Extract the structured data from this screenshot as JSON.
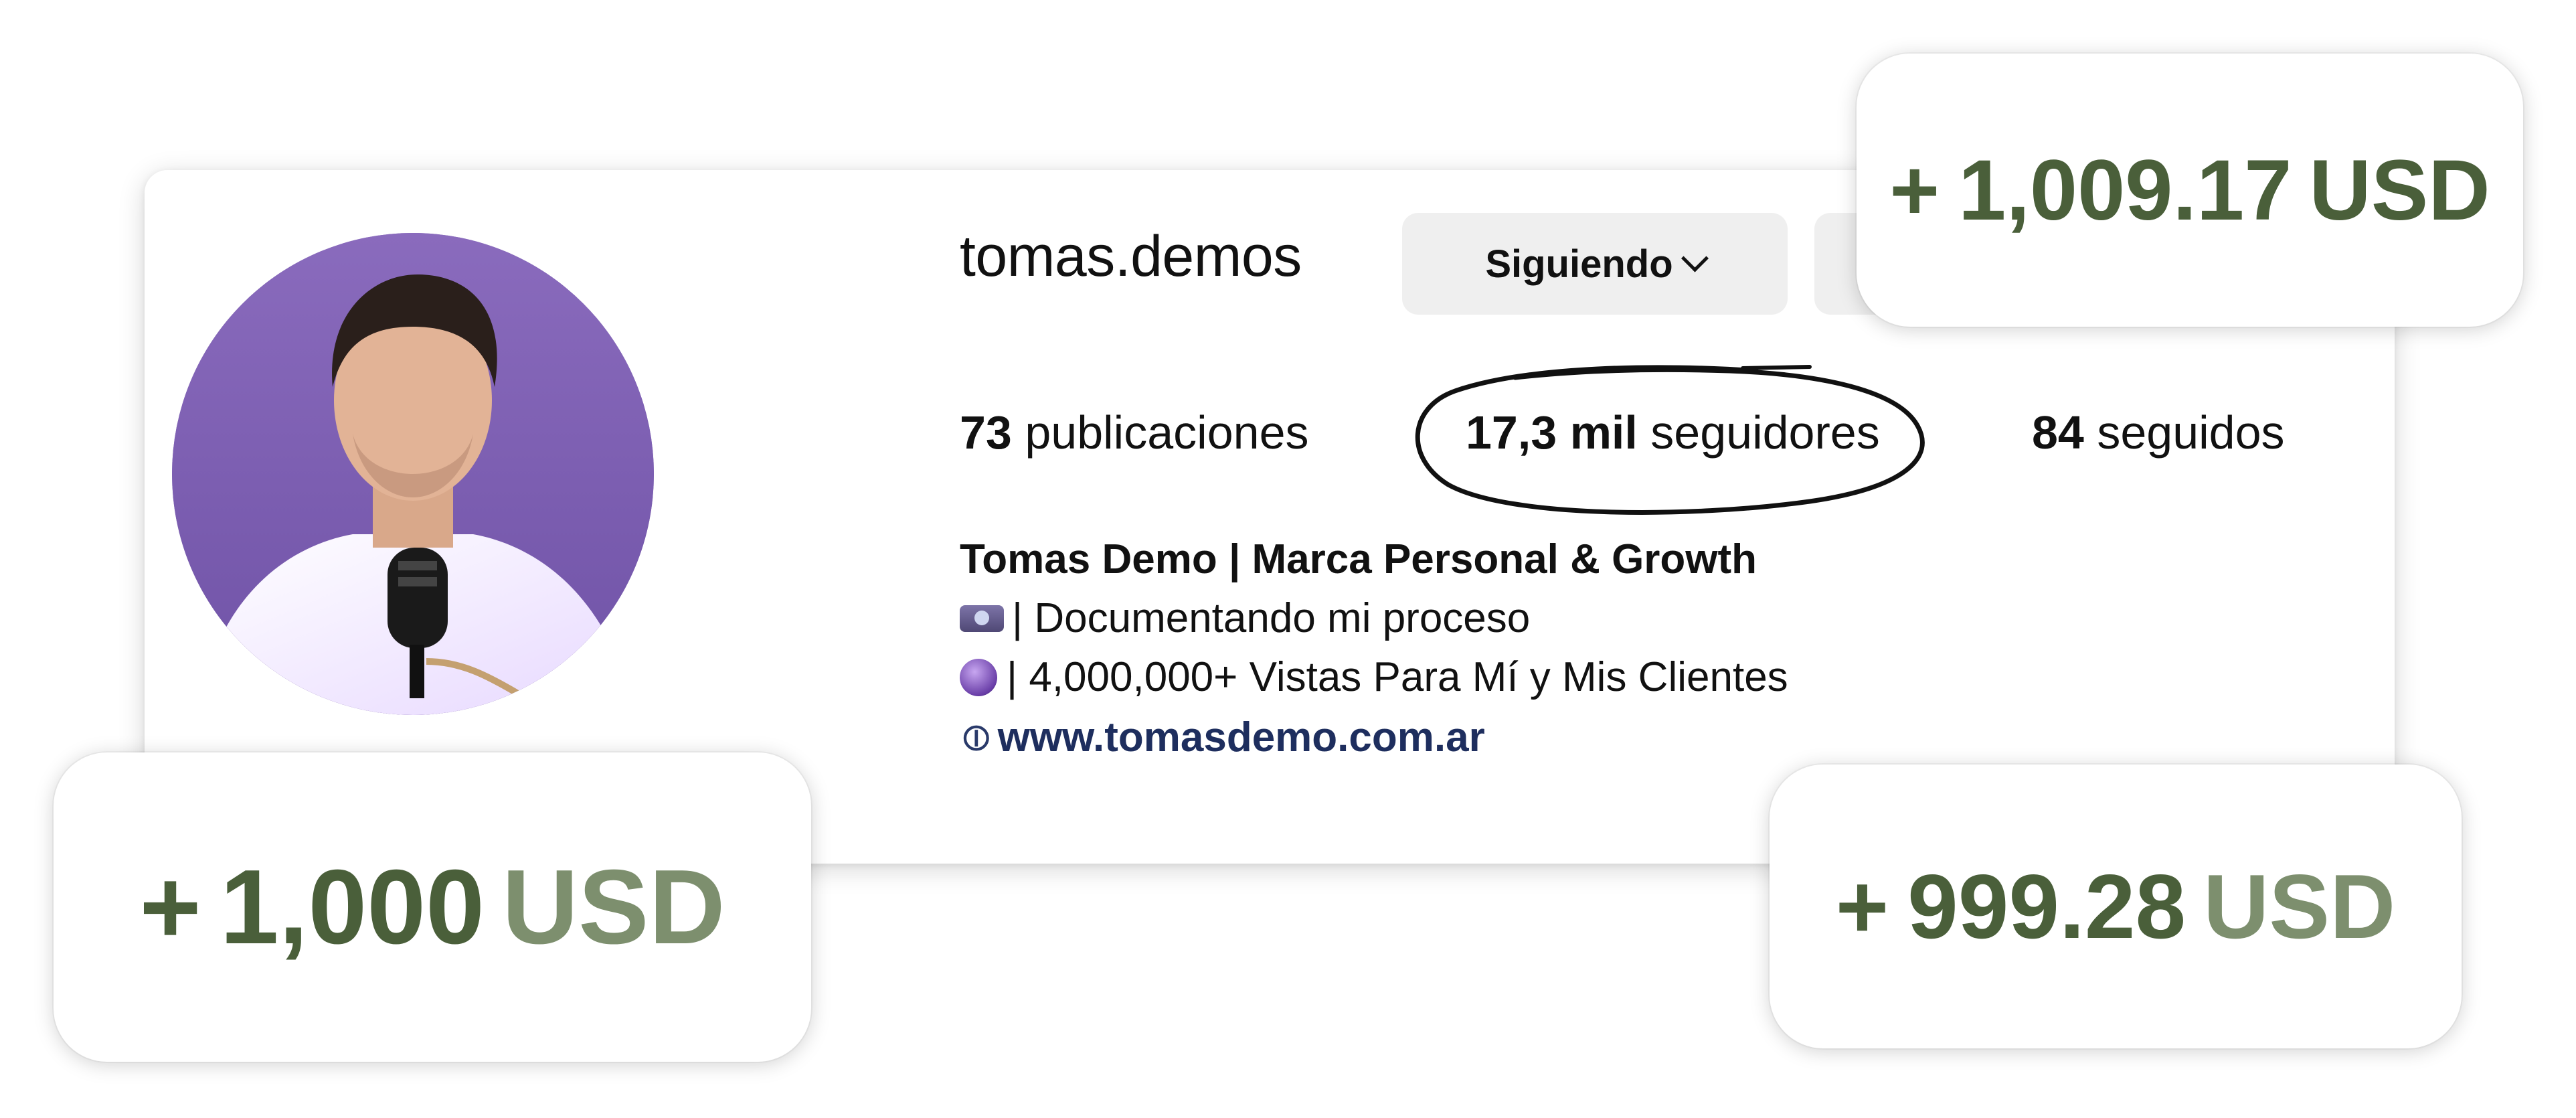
{
  "profile": {
    "username": "tomas.demos",
    "following_button_label": "Siguiendo",
    "stats": {
      "posts_count": "73",
      "posts_label": "publicaciones",
      "followers_count": "17,3 mil",
      "followers_label": "seguidores",
      "following_count": "84",
      "following_label": "seguidos"
    },
    "bio": {
      "name": "Tomas Demo | Marca Personal & Growth",
      "line1": "| Documentando mi proceso",
      "line2": "| 4,000,000+ Vistas Para Mí y Mis Clientes",
      "link": "www.tomasdemo.com.ar"
    }
  },
  "badges": {
    "top": {
      "plus": "+",
      "amount": "1,009.17",
      "currency": "USD"
    },
    "left": {
      "plus": "+",
      "amount": "1,000",
      "currency": "USD"
    },
    "right": {
      "plus": "+",
      "amount": "999.28",
      "currency": "USD"
    }
  },
  "icons": {
    "chevron": "chevron-down-icon",
    "link": "link-icon",
    "camera_emoji": "video-camera-icon",
    "crystal_ball_emoji": "crystal-ball-icon"
  },
  "colors": {
    "badge_text": "#4a5f3a",
    "avatar_bg": "#7c5fb0",
    "link": "#1e2e5e"
  }
}
